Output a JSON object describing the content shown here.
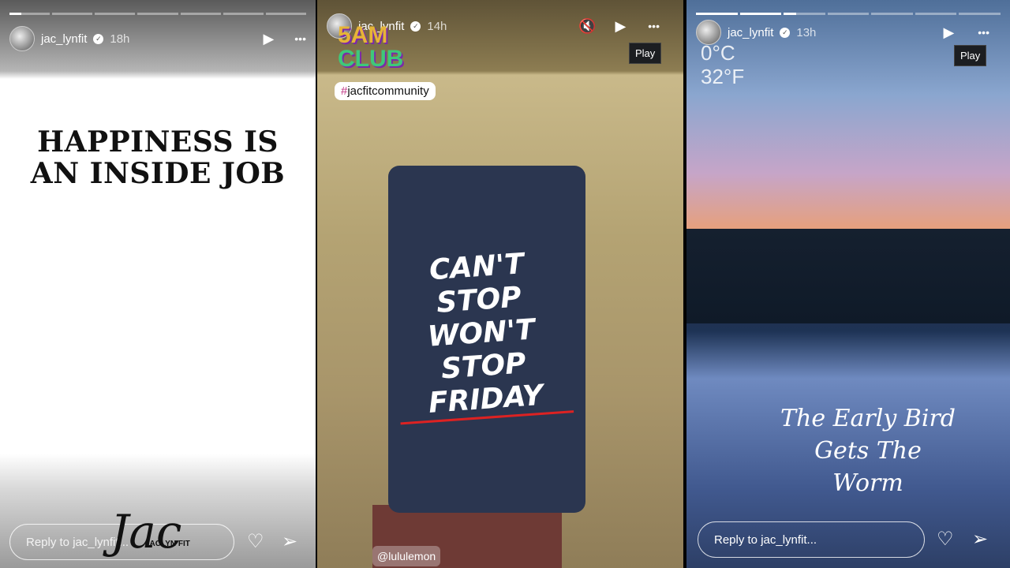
{
  "stories": [
    {
      "username": "jac_lynfit",
      "time": "18h",
      "progress": {
        "segments": 7,
        "current": 1,
        "current_fill": 0.3
      },
      "quote": [
        "HAPPINESS IS",
        "AN INSIDE JOB"
      ],
      "signature": "Jac",
      "signature_sub": "JACLYN FIT",
      "reply_placeholder": "Reply to jac_lynfit..."
    },
    {
      "username": "jac_lynfit",
      "time": "14h",
      "sticker": [
        "5AM",
        "CLUB"
      ],
      "hashtag_symbol": "#",
      "hashtag": "jacfitcommunity",
      "shirt_text": [
        "CAN'T STOP",
        "WON'T STOP",
        "FRIDAY"
      ],
      "mention": "@lululemon",
      "tooltip": "Play"
    },
    {
      "username": "jac_lynfit",
      "time": "13h",
      "progress": {
        "segments": 7,
        "current": 3,
        "current_fill": 0.3
      },
      "weather": [
        "0°C",
        "32°F"
      ],
      "caption": [
        "The Early Bird",
        "Gets The",
        "Worm"
      ],
      "tooltip": "Play",
      "reply_placeholder": "Reply to jac_lynfit..."
    }
  ],
  "icons": {
    "verified": "✓",
    "play": "▶",
    "more": "•••",
    "mute": "🔇",
    "heart": "♡",
    "send": "➢"
  }
}
